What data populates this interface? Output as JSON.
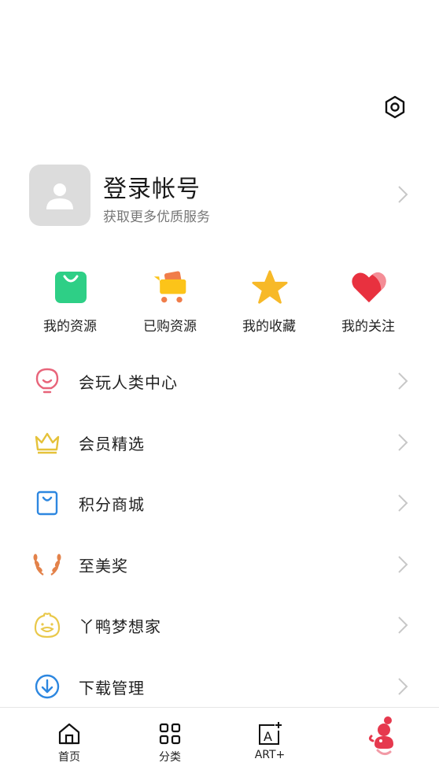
{
  "header": {
    "settings_icon": "gear-icon"
  },
  "profile": {
    "title": "登录帐号",
    "subtitle": "获取更多优质服务",
    "avatar_icon": "person-icon"
  },
  "quick_actions": [
    {
      "label": "我的资源",
      "icon": "green-bag-icon",
      "color": "#2ecf86"
    },
    {
      "label": "已购资源",
      "icon": "cart-icon",
      "color": "#f7b928"
    },
    {
      "label": "我的收藏",
      "icon": "star-icon",
      "color": "#f7b928"
    },
    {
      "label": "我的关注",
      "icon": "heart-icon",
      "color": "#e8313f"
    }
  ],
  "menu": [
    {
      "label": "会玩人类中心",
      "icon": "bulb-icon",
      "color": "#e8647a"
    },
    {
      "label": "会员精选",
      "icon": "crown-icon",
      "color": "#e5c23a"
    },
    {
      "label": "积分商城",
      "icon": "shopping-bag-icon",
      "color": "#2d87e0"
    },
    {
      "label": "至美奖",
      "icon": "laurel-icon",
      "color": "#e3824a"
    },
    {
      "label": "丫鸭梦想家",
      "icon": "duck-icon",
      "color": "#e9c84a"
    },
    {
      "label": "下载管理",
      "icon": "download-icon",
      "color": "#2d87e0"
    }
  ],
  "tabbar": [
    {
      "label": "首页",
      "icon": "home-icon"
    },
    {
      "label": "分类",
      "icon": "grid-icon"
    },
    {
      "label": "ART+",
      "icon": "art-plus-icon"
    },
    {
      "label": "",
      "icon": "mascot-icon"
    }
  ]
}
